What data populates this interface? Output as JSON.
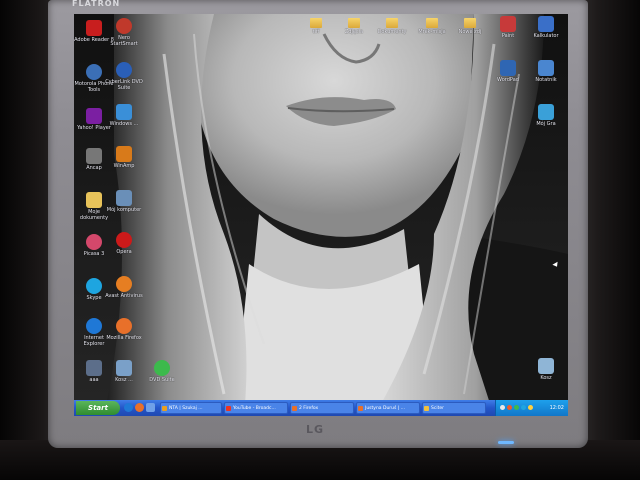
{
  "monitor": {
    "brand": "FLATRON",
    "logo": "LG"
  },
  "desktop": {
    "left_icons": [
      {
        "label": "Adobe Reader 8",
        "icon": "adobe-reader-icon",
        "color": "#c81e1e"
      },
      {
        "label": "Motorola Phone Tools",
        "icon": "phone-tools-icon",
        "color": "#3b6fb6"
      },
      {
        "label": "Yahoo! Player",
        "icon": "yahoo-player-icon",
        "color": "#7b1fa2"
      },
      {
        "label": "Ancap",
        "icon": "ancap-icon",
        "color": "#777777"
      },
      {
        "label": "Moje dokumenty",
        "icon": "documents-icon",
        "color": "#e8c35a"
      },
      {
        "label": "Picasa 3",
        "icon": "picasa-icon",
        "color": "#d4486b"
      },
      {
        "label": "Skype",
        "icon": "skype-icon",
        "color": "#1ea5e0"
      },
      {
        "label": "Internet Explorer",
        "icon": "internet-explorer-icon",
        "color": "#1f78d6"
      },
      {
        "label": "aaa",
        "icon": "shortcut-icon",
        "color": "#5c6e8a"
      }
    ],
    "second_icons": [
      {
        "label": "Nero StartSmart",
        "icon": "nero-icon",
        "color": "#c0392b"
      },
      {
        "label": "CyberLink DVD Suite",
        "icon": "cyberlink-icon",
        "color": "#2a5fb8"
      },
      {
        "label": "Windows ...",
        "icon": "windows-app-icon",
        "color": "#3a8fd8"
      },
      {
        "label": "WinAmp",
        "icon": "winamp-icon",
        "color": "#d87a1a"
      },
      {
        "label": "Mój komputer",
        "icon": "my-computer-icon",
        "color": "#6a8fb8"
      },
      {
        "label": "Opera",
        "icon": "opera-icon",
        "color": "#cc1a1a"
      },
      {
        "label": "Avast Antivirus",
        "icon": "avast-icon",
        "color": "#e67e22"
      },
      {
        "label": "Mozilla Firefox",
        "icon": "firefox-icon",
        "color": "#e8702a"
      },
      {
        "label": "Kosz ...",
        "icon": "recycle-icon",
        "color": "#7aa0c8"
      },
      {
        "label": "DVD Suite",
        "icon": "dvd-icon",
        "color": "#3cba4c"
      }
    ],
    "top_folders": [
      {
        "label": "tiff",
        "icon": "folder-icon"
      },
      {
        "label": "Zdjęcia",
        "icon": "folder-icon"
      },
      {
        "label": "Dokumenty",
        "icon": "folder-icon"
      },
      {
        "label": "Mrek-misja",
        "icon": "folder-icon"
      },
      {
        "label": "Nowe zdj",
        "icon": "folder-icon"
      }
    ],
    "right_icons": [
      {
        "label": "Paint",
        "icon": "paint-icon",
        "color": "#c73a3a"
      },
      {
        "label": "Kalkulator",
        "icon": "calculator-icon",
        "color": "#3a6fc8"
      },
      {
        "label": "WordPad",
        "icon": "wordpad-icon",
        "color": "#2f66b3"
      },
      {
        "label": "Notatnik",
        "icon": "notepad-icon",
        "color": "#4a86d0"
      },
      {
        "label": "Mój Gra",
        "icon": "game-icon",
        "color": "#3aa0d8"
      },
      {
        "label": "Kosz",
        "icon": "recycle-bin-icon",
        "color": "#8fb5d6"
      }
    ]
  },
  "taskbar": {
    "start_label": "Start",
    "tasks": [
      {
        "label": "NTA | Szukaj ...",
        "color": "#e8a020"
      },
      {
        "label": "YouTube - Broadc...",
        "color": "#ee3322"
      },
      {
        "label": "2 Firefox",
        "color": "#e8702a"
      },
      {
        "label": "Justyna Duruś | ...",
        "color": "#e8702a"
      },
      {
        "label": "Sciter",
        "color": "#f0c040"
      }
    ],
    "clock": "12:02"
  },
  "colors": {
    "taskbar": "#2456c8",
    "start": "#2f8c2f",
    "tray": "#1176c8"
  }
}
